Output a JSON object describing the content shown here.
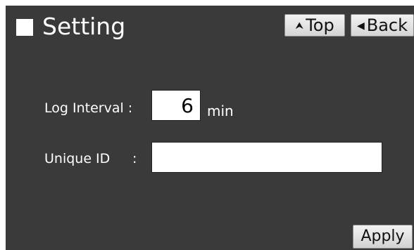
{
  "header": {
    "title": "Setting",
    "top_label": "Top",
    "back_label": "Back"
  },
  "form": {
    "log_interval_label": "Log Interval :",
    "log_interval_value": "6",
    "log_interval_unit": "min",
    "unique_id_label": "Unique ID",
    "unique_id_colon": ":",
    "unique_id_value": ""
  },
  "footer": {
    "apply_label": "Apply"
  },
  "icons": {
    "header_square": "square-icon",
    "top_arrow": "arrow-up-icon",
    "back_arrow": "triangle-left-icon"
  },
  "colors": {
    "background": "#3a3a3a",
    "text": "#ffffff",
    "button_face": "#e4e4e4"
  }
}
